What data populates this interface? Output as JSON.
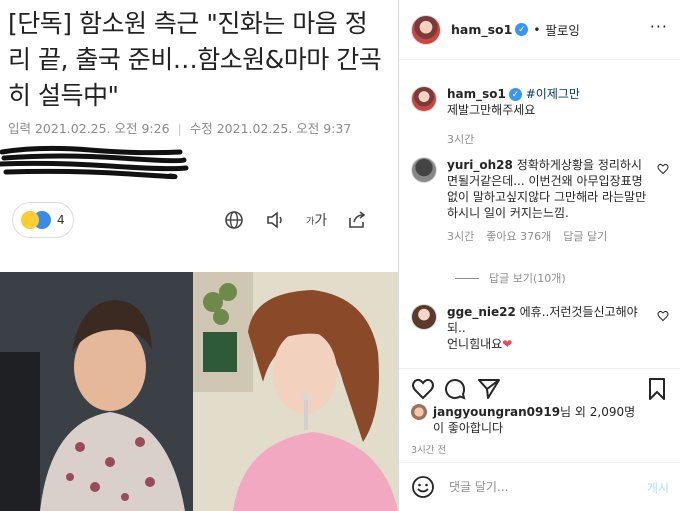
{
  "article": {
    "headline": "[단독] 함소원 측근 \"진화는 마음 정리 끝, 출국 준비…함소원&마마 간곡히 설득中\"",
    "published": "입력 2021.02.25. 오전 9:26",
    "modified": "수정 2021.02.25. 오전 9:37",
    "reaction_count": "4",
    "toolbar": {
      "globe_icon": "globe-icon",
      "audio_icon": "speaker-icon",
      "font_small": "가",
      "font_large": "가",
      "share_icon": "share-icon"
    }
  },
  "instagram": {
    "header": {
      "username": "ham_so1",
      "separator": "•",
      "follow_label": "팔로잉",
      "more": "···"
    },
    "caption": {
      "username": "ham_so1",
      "hashtag": "#이제그만",
      "text": "제발그만해주세요",
      "time": "3시간"
    },
    "comments": [
      {
        "username": "yuri_oh28",
        "text": "정확하게상황을 정리하시면될거같은데... 이번건왜 아무입장표명없이 말하고싶지않다 그만해라 라는말만하시니 일이 커지는느낌.",
        "time": "3시간",
        "likes": "좋아요 376개",
        "reply": "답글 달기"
      },
      {
        "username": "gge_nie22",
        "text": "에휴..저런것들신고해야되..",
        "text2": "언니힘내요",
        "heart": "❤"
      }
    ],
    "view_replies": "답글 보기(10개)",
    "liked_by": {
      "user": "jangyoungran0919",
      "suffix": "님 외 2,090명",
      "line2": "이 좋아합니다"
    },
    "time_ago": "3시간 전",
    "comment_placeholder": "댓글 달기...",
    "post_label": "게시"
  },
  "colors": {
    "verified": "#3897f0",
    "link": "#00376b",
    "muted": "#8e8e8e",
    "post_disabled": "#b2dffc",
    "heart": "#ed4956"
  }
}
